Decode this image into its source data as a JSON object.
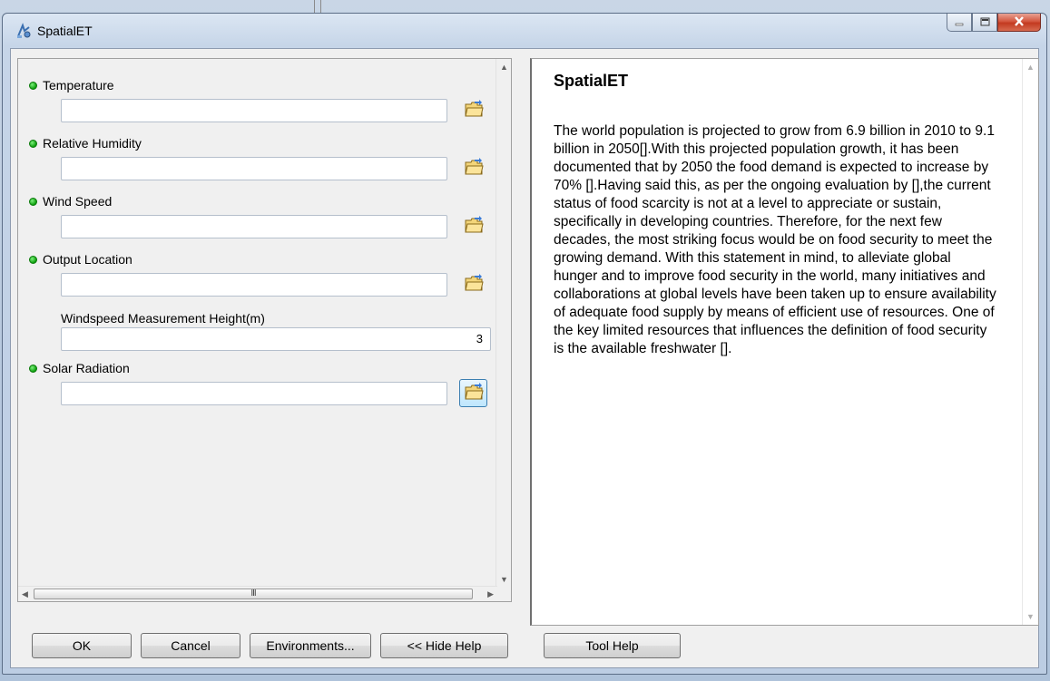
{
  "window": {
    "title": "SpatialET"
  },
  "params": [
    {
      "label": "Temperature",
      "value": ""
    },
    {
      "label": "Relative Humidity",
      "value": ""
    },
    {
      "label": "Wind Speed",
      "value": ""
    },
    {
      "label": "Output Location",
      "value": ""
    },
    {
      "label": "Windspeed Measurement Height(m)",
      "value": "3"
    },
    {
      "label": "Solar Radiation",
      "value": ""
    }
  ],
  "help": {
    "title": "SpatialET",
    "body": "The world population is projected to grow from 6.9 billion in 2010 to 9.1 billion in 2050[].With this projected population growth, it has been documented that by 2050 the food demand is expected to increase by 70% [].Having said this, as per the ongoing evaluation by [],the current status of food scarcity is not at a level to appreciate or sustain, specifically in developing countries. Therefore, for the next few decades, the most striking focus would be on food security to meet the growing demand. With this statement in mind, to alleviate global hunger and to improve food security in the world, many initiatives and collaborations at global levels have been taken up to ensure availability of adequate food supply by means of efficient use of resources. One of the key limited resources that influences the definition of food security is the available freshwater []."
  },
  "buttons": {
    "ok": "OK",
    "cancel": "Cancel",
    "environments": "Environments...",
    "hide_help": "<< Hide Help",
    "tool_help": "Tool Help"
  },
  "scrollbar": {
    "thumb_grip": "III"
  }
}
